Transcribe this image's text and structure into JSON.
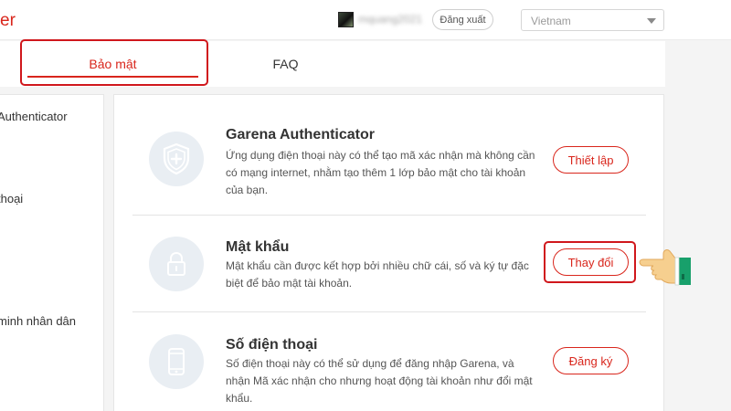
{
  "header": {
    "brand_fragment": "er",
    "username": "mquang2021",
    "logout_label": "Đăng xuất",
    "language": "Vietnam"
  },
  "tabs": [
    {
      "label": "Bảo mật",
      "active": true
    },
    {
      "label": "FAQ",
      "active": false
    }
  ],
  "sidebar": {
    "items": [
      {
        "label": "Authenticator"
      },
      {
        "label": "thoại"
      },
      {
        "label": "minh nhân dân"
      }
    ]
  },
  "security": {
    "items": [
      {
        "title": "Garena Authenticator",
        "description": "Ứng dụng điện thoại này có thể tạo mã xác nhận mà không cần có mạng internet, nhằm tạo thêm 1 lớp bảo mật cho tài khoản của bạn.",
        "button": "Thiết lập",
        "icon": "shield-plus-icon"
      },
      {
        "title": "Mật khẩu",
        "description": "Mật khẩu cần được kết hợp bởi nhiều chữ cái, số và ký tự đặc biệt để bảo mật tài khoản.",
        "button": "Thay đổi",
        "icon": "lock-icon"
      },
      {
        "title": "Số điện thoại",
        "description": "Số điện thoại này có thể sử dụng để đăng nhập Garena, và nhận Mã xác nhận cho nhưng hoạt động tài khoản như đổi mật khẩu.",
        "button": "Đăng ký",
        "icon": "phone-icon"
      }
    ]
  },
  "colors": {
    "accent": "#d9261c",
    "highlight": "#d0171c",
    "icon_bg": "#e9eef3"
  }
}
